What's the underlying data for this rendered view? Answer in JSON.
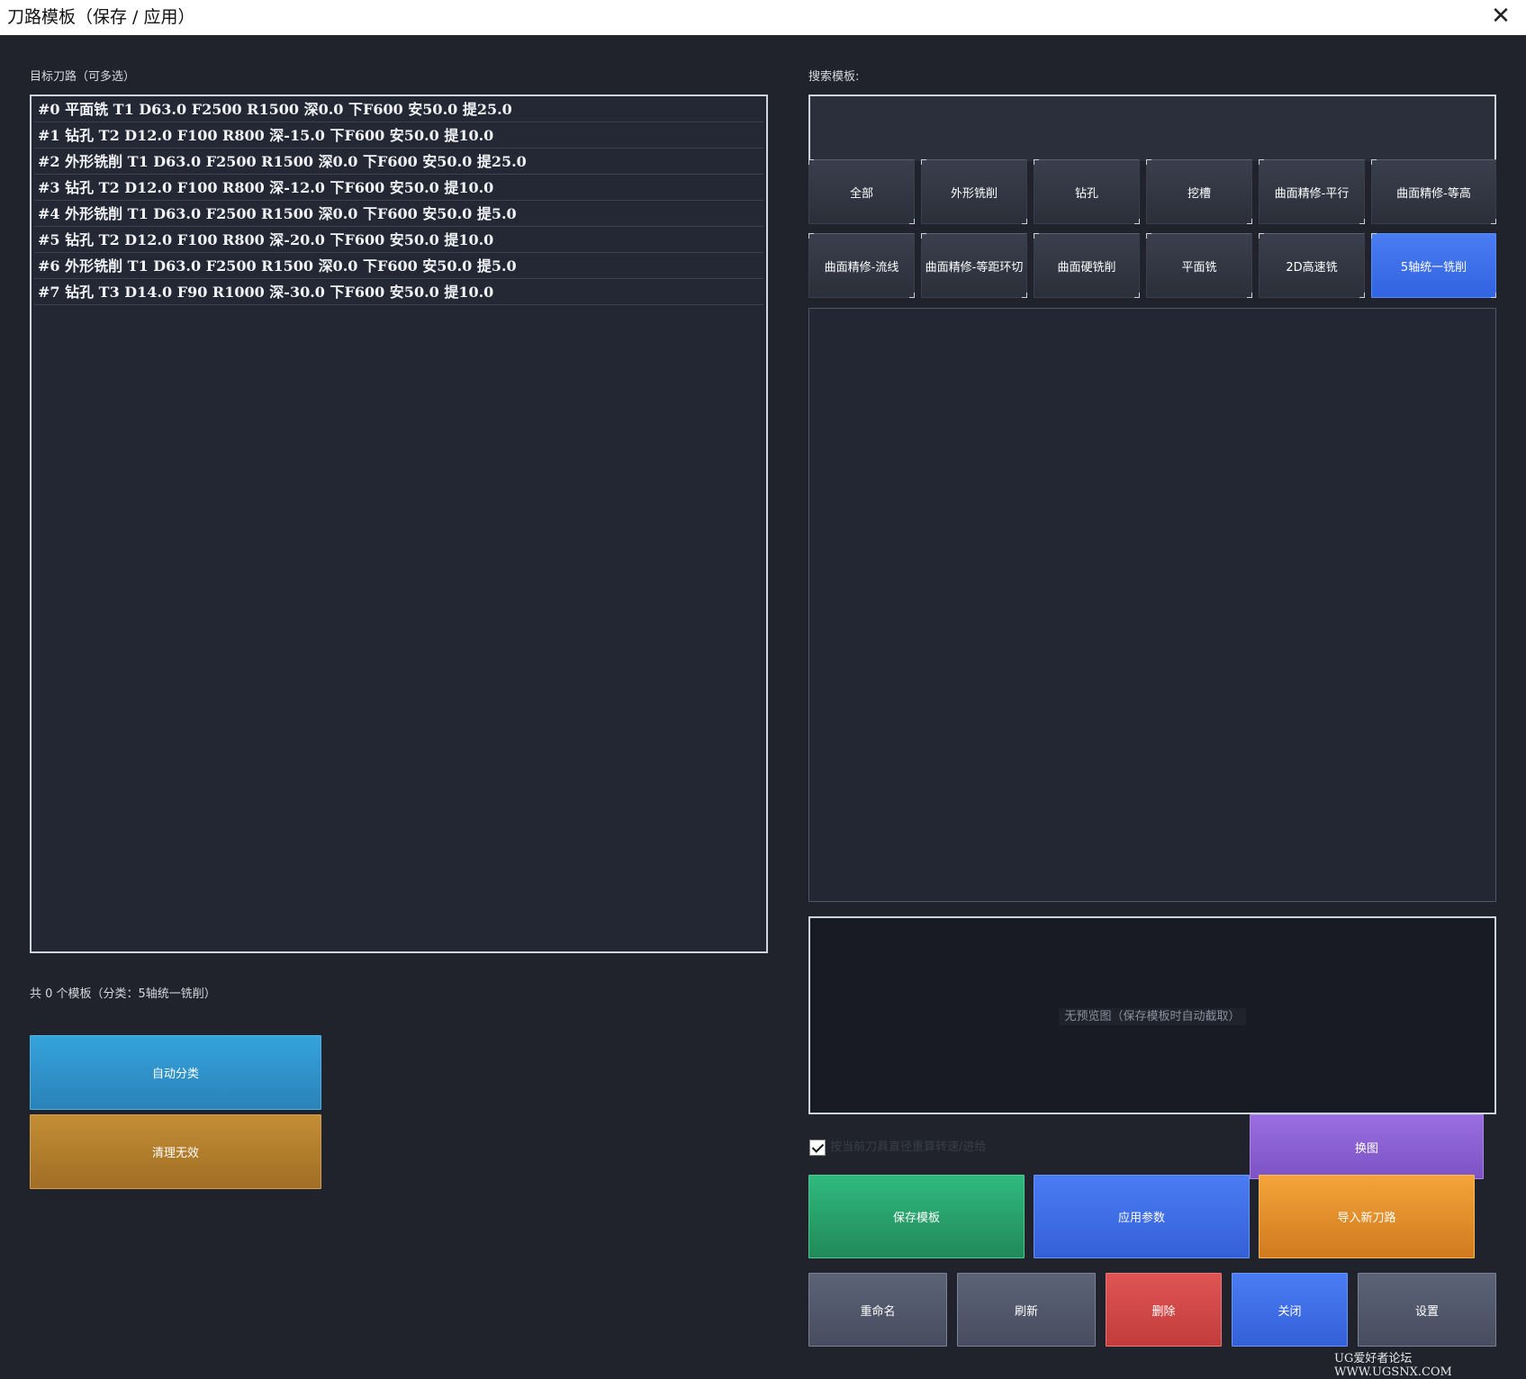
{
  "window": {
    "title": "刀路模板（保存 / 应用）",
    "close_glyph": "✕"
  },
  "left": {
    "target_label": "目标刀路（可多选）",
    "toolpaths": [
      "#0 平面铣 T1 D63.0 F2500 R1500 深0.0 下F600 安50.0 提25.0",
      "#1 钻孔 T2 D12.0 F100 R800 深-15.0 下F600 安50.0 提10.0",
      "#2 外形铣削 T1 D63.0 F2500 R1500 深0.0 下F600 安50.0 提25.0",
      "#3 钻孔 T2 D12.0 F100 R800 深-12.0 下F600 安50.0 提10.0",
      "#4 外形铣削 T1 D63.0 F2500 R1500 深0.0 下F600 安50.0 提5.0",
      "#5 钻孔 T2 D12.0 F100 R800 深-20.0 下F600 安50.0 提10.0",
      "#6 外形铣削 T1 D63.0 F2500 R1500 深0.0 下F600 安50.0 提5.0",
      "#7 钻孔 T3 D14.0 F90 R1000 深-30.0 下F600 安50.0 提10.0"
    ],
    "count_text": "共 0 个模板（分类：5轴统一铣削）",
    "auto_classify": "自动分类",
    "clean_invalid": "清理无效"
  },
  "right": {
    "search_label": "搜索模板:",
    "categories_row1": [
      "全部",
      "外形铣削",
      "钻孔",
      "挖槽",
      "曲面精修-平行",
      "曲面精修-等高"
    ],
    "categories_row2": [
      "曲面精修-流线",
      "曲面精修-等距环切",
      "曲面硬铣削",
      "平面铣",
      "2D高速铣",
      "5轴统一铣削"
    ],
    "active_category": "5轴统一铣削",
    "preview_placeholder": "无预览图（保存模板时自动截取）",
    "recalc_checkbox": {
      "label": "按当前刀具直径重算转速/进给",
      "checked": true
    },
    "change_image": "换图",
    "save_template": "保存模板",
    "apply_params": "应用参数",
    "import_toolpath": "导入新刀路",
    "rename": "重命名",
    "refresh": "刷新",
    "delete": "删除",
    "close": "关闭",
    "settings": "设置"
  },
  "colors": {
    "background": "#20232c",
    "blue": "#3a6ee8",
    "green": "#2a9f6a",
    "orange": "#e48a2a",
    "purple": "#8a5ed0",
    "red": "#d24646",
    "slate": "#4f5669",
    "teal": "#2e8fc4",
    "gold": "#b07d2c"
  },
  "watermark": "UG爱好者论坛 WWW.UGSNX.COM"
}
